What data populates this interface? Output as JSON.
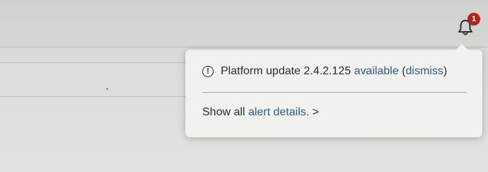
{
  "notifications": {
    "badge_count": "1",
    "icon": "bell-icon"
  },
  "popover": {
    "alert": {
      "icon": "info-circle-icon",
      "icon_glyph": "!",
      "message": "Platform update 2.4.2.125",
      "available_link": "available",
      "dismiss_open": "(",
      "dismiss_link": "dismiss",
      "dismiss_close": ")"
    },
    "details": {
      "prefix": "Show all",
      "link": "alert details.",
      "chevron": ">"
    }
  },
  "colors": {
    "link": "#2e5c86",
    "badge": "#b3221f",
    "popover_bg": "#f1f1ef",
    "text": "#2d2d2d"
  }
}
